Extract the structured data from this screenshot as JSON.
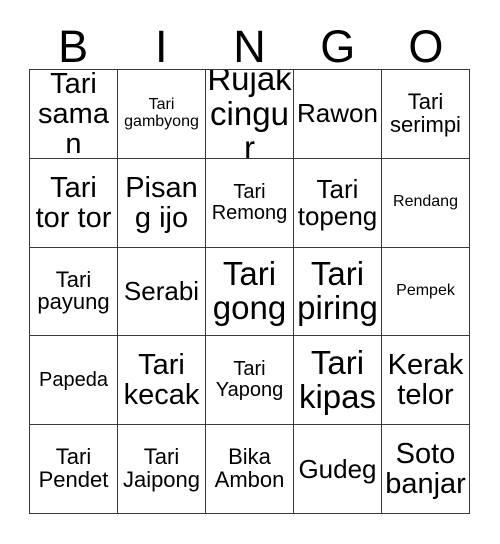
{
  "card": {
    "headers": [
      "B",
      "I",
      "N",
      "G",
      "O"
    ],
    "rows": [
      [
        {
          "text": "Tari saman",
          "size": "lg"
        },
        {
          "text": "Tari gambyong",
          "size": "xxs"
        },
        {
          "text": "Rujak cingur",
          "size": "xl"
        },
        {
          "text": "Rawon",
          "size": "md"
        },
        {
          "text": "Tari serimpi",
          "size": "sm"
        }
      ],
      [
        {
          "text": "Tari tor tor",
          "size": "lg"
        },
        {
          "text": "Pisang ijo",
          "size": "lg"
        },
        {
          "text": "Tari Remong",
          "size": "xs"
        },
        {
          "text": "Tari topeng",
          "size": "md"
        },
        {
          "text": "Rendang",
          "size": "xxs"
        }
      ],
      [
        {
          "text": "Tari payung",
          "size": "sm"
        },
        {
          "text": "Serabi",
          "size": "md"
        },
        {
          "text": "Tari gong",
          "size": "xl"
        },
        {
          "text": "Tari piring",
          "size": "xl"
        },
        {
          "text": "Pempek",
          "size": "xxs"
        }
      ],
      [
        {
          "text": "Papeda",
          "size": "xs"
        },
        {
          "text": "Tari kecak",
          "size": "lg"
        },
        {
          "text": "Tari Yapong",
          "size": "xs"
        },
        {
          "text": "Tari kipas",
          "size": "xl"
        },
        {
          "text": "Kerak telor",
          "size": "lg"
        }
      ],
      [
        {
          "text": "Tari Pendet",
          "size": "sm"
        },
        {
          "text": "Tari Jaipong",
          "size": "sm"
        },
        {
          "text": "Bika Ambon",
          "size": "sm"
        },
        {
          "text": "Gudeg",
          "size": "md"
        },
        {
          "text": "Soto banjar",
          "size": "lg"
        }
      ]
    ]
  },
  "colors": {
    "border": "#3a3a3a",
    "text": "#000000",
    "background": "#ffffff"
  }
}
